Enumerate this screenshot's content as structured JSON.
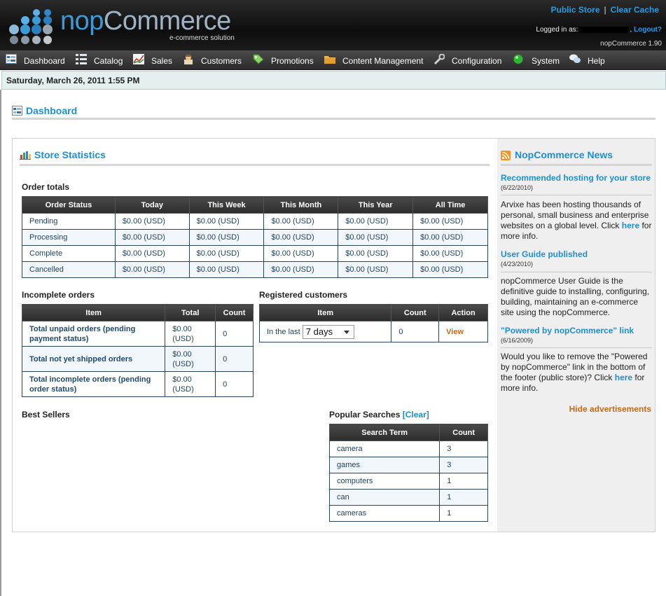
{
  "header": {
    "logo_main": "nop",
    "logo_rest": "Commerce",
    "logo_sub": "e-commerce solution",
    "public_store": "Public Store",
    "separator": "|",
    "clear_cache": "Clear Cache",
    "logged_in_as": "Logged in as:",
    "logout": "Logout?",
    "version": "nopCommerce 1.90"
  },
  "nav": {
    "items": [
      {
        "label": "Dashboard"
      },
      {
        "label": "Catalog"
      },
      {
        "label": "Sales"
      },
      {
        "label": "Customers"
      },
      {
        "label": "Promotions"
      },
      {
        "label": "Content Management"
      },
      {
        "label": "Configuration"
      },
      {
        "label": "System"
      },
      {
        "label": "Help"
      }
    ]
  },
  "date": "Saturday, March 26, 2011 1:55 PM",
  "page_title": "Dashboard",
  "store_stats": {
    "title": "Store Statistics",
    "order_totals": {
      "title": "Order totals",
      "headers": [
        "Order Status",
        "Today",
        "This Week",
        "This Month",
        "This Year",
        "All Time"
      ],
      "rows": [
        [
          "Pending",
          "$0.00 (USD)",
          "$0.00 (USD)",
          "$0.00 (USD)",
          "$0.00 (USD)",
          "$0.00 (USD)"
        ],
        [
          "Processing",
          "$0.00 (USD)",
          "$0.00 (USD)",
          "$0.00 (USD)",
          "$0.00 (USD)",
          "$0.00 (USD)"
        ],
        [
          "Complete",
          "$0.00 (USD)",
          "$0.00 (USD)",
          "$0.00 (USD)",
          "$0.00 (USD)",
          "$0.00 (USD)"
        ],
        [
          "Cancelled",
          "$0.00 (USD)",
          "$0.00 (USD)",
          "$0.00 (USD)",
          "$0.00 (USD)",
          "$0.00 (USD)"
        ]
      ]
    },
    "incomplete_orders": {
      "title": "Incomplete orders",
      "headers": [
        "Item",
        "Total",
        "Count"
      ],
      "rows": [
        {
          "item": "Total unpaid orders (pending payment status)",
          "total": "$0.00 (USD)",
          "count": "0"
        },
        {
          "item": "Total not yet shipped orders",
          "total": "$0.00 (USD)",
          "count": "0"
        },
        {
          "item": "Total incomplete orders (pending order status)",
          "total": "$0.00 (USD)",
          "count": "0"
        }
      ]
    },
    "registered_customers": {
      "title": "Registered customers",
      "headers": [
        "Item",
        "Count",
        "Action"
      ],
      "in_the_last": "In the last",
      "period": "7 days",
      "count": "0",
      "action": "View"
    },
    "best_sellers": {
      "title": "Best Sellers"
    },
    "popular_searches": {
      "title": "Popular Searches",
      "clear": "[Clear]",
      "headers": [
        "Search Term",
        "Count"
      ],
      "rows": [
        {
          "term": "camera",
          "count": "3"
        },
        {
          "term": "games",
          "count": "3"
        },
        {
          "term": "computers",
          "count": "1"
        },
        {
          "term": "can",
          "count": "1"
        },
        {
          "term": "cameras",
          "count": "1"
        }
      ]
    }
  },
  "news": {
    "title": "NopCommerce News",
    "items": [
      {
        "title": "Recommended hosting for your store",
        "date": "(6/22/2010)",
        "body": "Arvixe has been hosting thousands of personal, small business and enterprise websites on a global level. Click ",
        "link": "here",
        "tail": " for more info."
      },
      {
        "title": "User Guide published",
        "date": "(4/23/2010)",
        "body": "nopCommerce User Guide is the definitive guide to installing, configuring, building, maintaining an e-commerce site using the nopCommerce.",
        "link": "",
        "tail": ""
      },
      {
        "title": "\"Powered by nopCommerce\" link",
        "date": "(6/16/2009)",
        "body": "Would you like to remove the \"Powered by nopCommerce\" link in the bottom of the footer (public store)? Click ",
        "link": "here",
        "tail": " for more info."
      }
    ],
    "hide_ads": "Hide advertisements"
  },
  "colors": {
    "accent": "#1e8fd5",
    "action": "#c96a1a"
  }
}
